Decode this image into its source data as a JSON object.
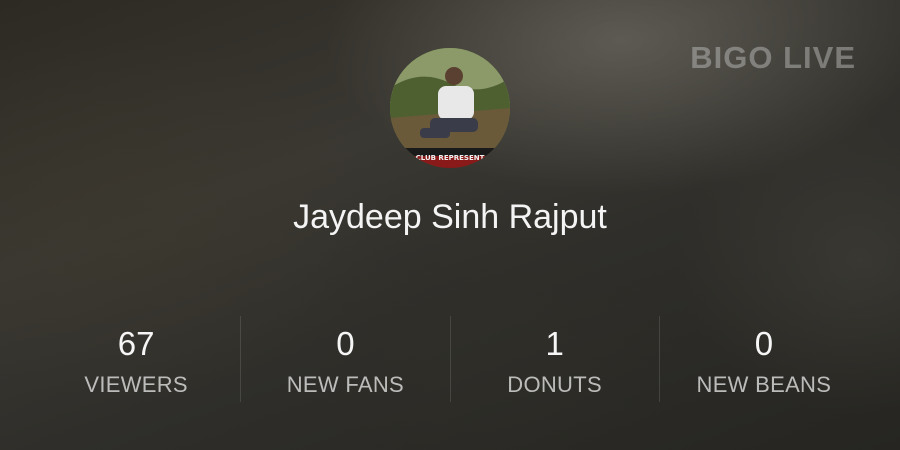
{
  "watermark": "BIGO LIVE",
  "user": {
    "name": "Jaydeep Sinh Rajput",
    "avatar_caption": "CLUB REPRESENT"
  },
  "stats": [
    {
      "value": "67",
      "label": "VIEWERS"
    },
    {
      "value": "0",
      "label": "NEW FANS"
    },
    {
      "value": "1",
      "label": "DONUTS"
    },
    {
      "value": "0",
      "label": "NEW BEANS"
    }
  ]
}
